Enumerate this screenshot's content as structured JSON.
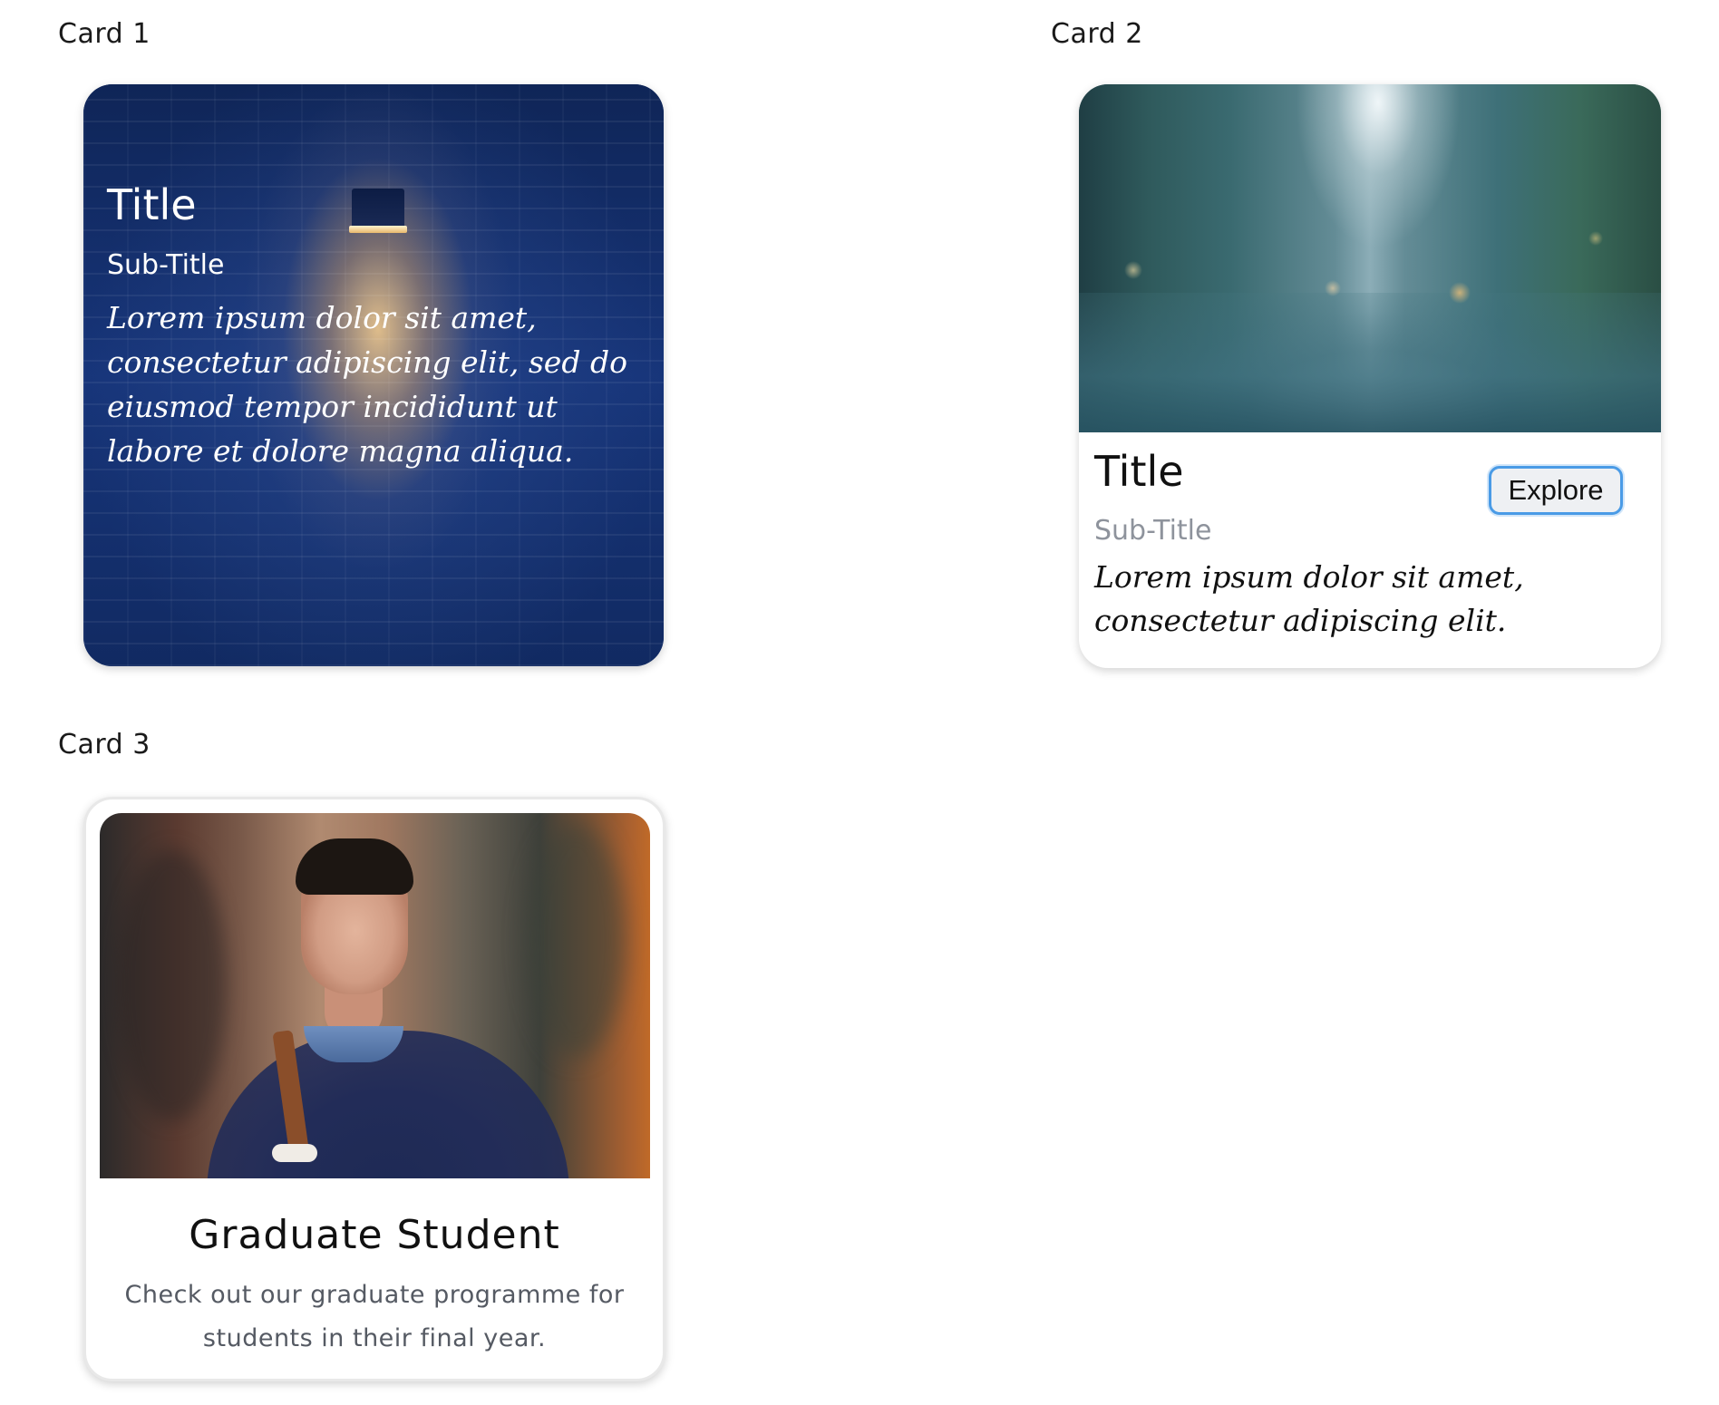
{
  "labels": {
    "card1": "Card 1",
    "card2": "Card 2",
    "card3": "Card 3"
  },
  "card1": {
    "title": "Title",
    "subtitle": "Sub-Title",
    "body": "Lorem ipsum dolor sit amet, consectetur adipiscing elit, sed do eiusmod tempor incididunt ut labore et dolore magna aliqua.",
    "image": "wall-lamp-photo"
  },
  "card2": {
    "title": "Title",
    "subtitle": "Sub-Title",
    "body": "Lorem ipsum dolor sit amet, consectetur adipiscing elit.",
    "button_label": "Explore",
    "image": "rainy-city-street-photo"
  },
  "card3": {
    "title": "Graduate Student",
    "body": "Check out our graduate programme for students in their final year.",
    "image": "smiling-student-photo"
  },
  "colors": {
    "card1_background": "#14306a",
    "subtitle_gray": "#8e939c",
    "button_border": "#4a9be6",
    "body_gray": "#555a63"
  }
}
